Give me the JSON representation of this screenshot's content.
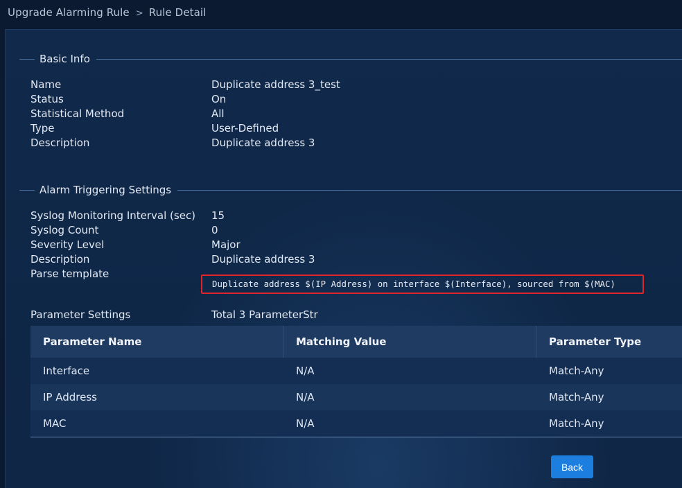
{
  "breadcrumb": {
    "parent": "Upgrade Alarming Rule",
    "separator": ">",
    "current": "Rule Detail"
  },
  "basic_info": {
    "title": "Basic Info",
    "fields": [
      {
        "label": "Name",
        "value": "Duplicate address 3_test"
      },
      {
        "label": "Status",
        "value": "On"
      },
      {
        "label": "Statistical Method",
        "value": "All"
      },
      {
        "label": "Type",
        "value": "User-Defined"
      },
      {
        "label": "Description",
        "value": "Duplicate address 3"
      }
    ]
  },
  "alarm_settings": {
    "title": "Alarm Triggering Settings",
    "fields": [
      {
        "label": "Syslog Monitoring Interval (sec)",
        "value": "15"
      },
      {
        "label": "Syslog Count",
        "value": "0"
      },
      {
        "label": "Severity Level",
        "value": "Major"
      },
      {
        "label": "Description",
        "value": "Duplicate address 3"
      }
    ],
    "parse_template_label": "Parse template",
    "parse_template_value": "Duplicate address $(IP Address) on interface $(Interface), sourced from $(MAC)"
  },
  "parameter_settings": {
    "label": "Parameter Settings",
    "summary": "Total 3 ParameterStr",
    "columns": [
      "Parameter Name",
      "Matching Value",
      "Parameter Type"
    ],
    "rows": [
      [
        "Interface",
        "N/A",
        "Match-Any"
      ],
      [
        "IP Address",
        "N/A",
        "Match-Any"
      ],
      [
        "MAC",
        "N/A",
        "Match-Any"
      ]
    ]
  },
  "actions": {
    "back_label": "Back"
  },
  "colors": {
    "background": "#0d1b33",
    "panel": "#10284a",
    "table_header": "#1f3b62",
    "highlight_border": "#e0242a",
    "primary_button": "#1c7fe0"
  }
}
